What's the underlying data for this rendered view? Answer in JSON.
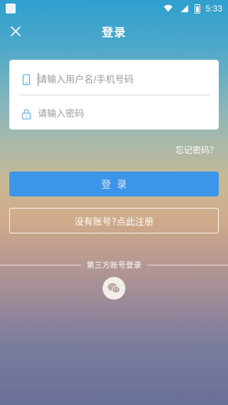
{
  "status_bar": {
    "time": "5:33"
  },
  "header": {
    "title": "登录",
    "close_icon": "close-icon"
  },
  "form": {
    "username_placeholder": "请输入用户名/手机号码",
    "password_placeholder": "请输入密码",
    "username_value": "",
    "password_value": ""
  },
  "links": {
    "forgot_password": "忘记密码？"
  },
  "buttons": {
    "login_label": "登录",
    "register_label": "没有账号?点此注册"
  },
  "third_party": {
    "label": "第三方账号登录",
    "wechat_icon": "wechat-icon"
  },
  "colors": {
    "primary_button": "#3c95e8",
    "icon_blue": "#6aaee6"
  }
}
